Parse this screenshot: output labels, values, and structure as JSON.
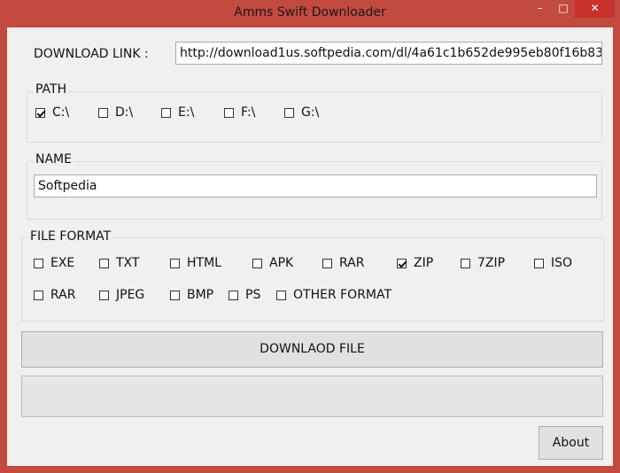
{
  "window": {
    "title": "Amms Swift Downloader",
    "minimize": "–",
    "maximize": "□",
    "close": "✕"
  },
  "link": {
    "label": "DOWNLOAD LINK :",
    "value": "http://download1us.softpedia.com/dl/4a61c1b652de995eb80f16b83"
  },
  "path": {
    "title": "PATH",
    "options": [
      {
        "label": "C:\\",
        "checked": true
      },
      {
        "label": "D:\\",
        "checked": false
      },
      {
        "label": "E:\\",
        "checked": false
      },
      {
        "label": "F:\\",
        "checked": false
      },
      {
        "label": "G:\\",
        "checked": false
      }
    ]
  },
  "name": {
    "title": "NAME",
    "value": "Softpedia"
  },
  "format": {
    "title": "FILE FORMAT",
    "row1": [
      {
        "label": "EXE",
        "checked": false
      },
      {
        "label": "TXT",
        "checked": false
      },
      {
        "label": "HTML",
        "checked": false
      },
      {
        "label": "APK",
        "checked": false
      },
      {
        "label": "RAR",
        "checked": false
      },
      {
        "label": "ZIP",
        "checked": true
      },
      {
        "label": "7ZIP",
        "checked": false
      },
      {
        "label": "ISO",
        "checked": false
      }
    ],
    "row2": [
      {
        "label": "RAR",
        "checked": false
      },
      {
        "label": "JPEG",
        "checked": false
      },
      {
        "label": "BMP",
        "checked": false
      },
      {
        "label": "PS",
        "checked": false
      },
      {
        "label": "OTHER FORMAT",
        "checked": false
      }
    ]
  },
  "buttons": {
    "download": "DOWNLAOD FILE",
    "about": "About"
  },
  "progress": {
    "value": 0
  }
}
